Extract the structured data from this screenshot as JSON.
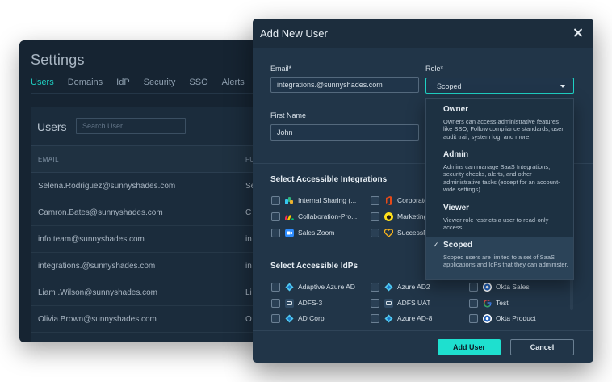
{
  "settings": {
    "title": "Settings",
    "tabs": [
      "Users",
      "Domains",
      "IdP",
      "Security",
      "SSO",
      "Alerts"
    ],
    "active_tab": "Users",
    "users_title": "Users",
    "search_placeholder": "Search User",
    "columns": [
      "EMAIL",
      "FU"
    ],
    "rows": [
      {
        "email": "Selena.Rodriguez@sunnyshades.com",
        "col2": "Se"
      },
      {
        "email": "Camron.Bates@sunnyshades.com",
        "col2": "C"
      },
      {
        "email": "info.team@sunnyshades.com",
        "col2": "in"
      },
      {
        "email": "integrations.@sunnyshades.com",
        "col2": "in"
      },
      {
        "email": "Liam .Wilson@sunnyshades.com",
        "col2": "Li"
      },
      {
        "email": "Olivia.Brown@sunnyshades.com",
        "col2": "O"
      },
      {
        "email": "",
        "col2": ""
      }
    ]
  },
  "modal": {
    "title": "Add New User",
    "email_label": "Email*",
    "email_value": "integrations.@sunnyshades.com",
    "role_label": "Role*",
    "role_value": "Scoped",
    "first_name_label": "First Name",
    "first_name_value": "John",
    "integrations_title": "Select Accessible Integrations",
    "integrations": [
      {
        "label": "Internal Sharing (...",
        "icon": "slack-icon"
      },
      {
        "label": "Corporate",
        "icon": "office-icon"
      },
      {
        "label": "Collaboration-Pro...",
        "icon": "monday-icon"
      },
      {
        "label": "Marketing",
        "icon": "mailchimp-icon"
      },
      {
        "label": "Sales Zoom",
        "icon": "zoom-icon"
      },
      {
        "label": "SuccessF",
        "icon": "heart-icon"
      }
    ],
    "idps_title": "Select Accessible IdPs",
    "idps": [
      {
        "label": "Adaptive Azure AD",
        "icon": "azure-icon"
      },
      {
        "label": "Azure AD2",
        "icon": "azure-icon"
      },
      {
        "label": "Okta Sales",
        "icon": "okta-icon"
      },
      {
        "label": "ADFS-3",
        "icon": "adfs-icon"
      },
      {
        "label": "ADFS UAT",
        "icon": "adfs-icon"
      },
      {
        "label": "Test",
        "icon": "google-icon"
      },
      {
        "label": "AD Corp",
        "icon": "azure-icon"
      },
      {
        "label": "Azure AD-8",
        "icon": "azure-icon"
      },
      {
        "label": "Okta Product",
        "icon": "okta-icon"
      }
    ],
    "add_button": "Add User",
    "cancel_button": "Cancel"
  },
  "role_menu": {
    "options": [
      {
        "name": "Owner",
        "description": "Owners can access administrative features like SSO, Follow compliance standards, user audit trail, system log, and more.",
        "selected": false
      },
      {
        "name": "Admin",
        "description": "Admins can manage SaaS Integrations, security checks, alerts, and other administrative tasks (except for an account-wide settings).",
        "selected": false
      },
      {
        "name": "Viewer",
        "description": "Viewer role restricts a user to read-only access.",
        "selected": false
      },
      {
        "name": "Scoped",
        "description": "Scoped users are limited to a set of SaaS applications and IdPs that they can administer.",
        "selected": true,
        "check": "✓"
      }
    ]
  },
  "colors": {
    "accent": "#1ee0cf",
    "modal_bg": "#213548",
    "settings_bg": "#162432"
  }
}
